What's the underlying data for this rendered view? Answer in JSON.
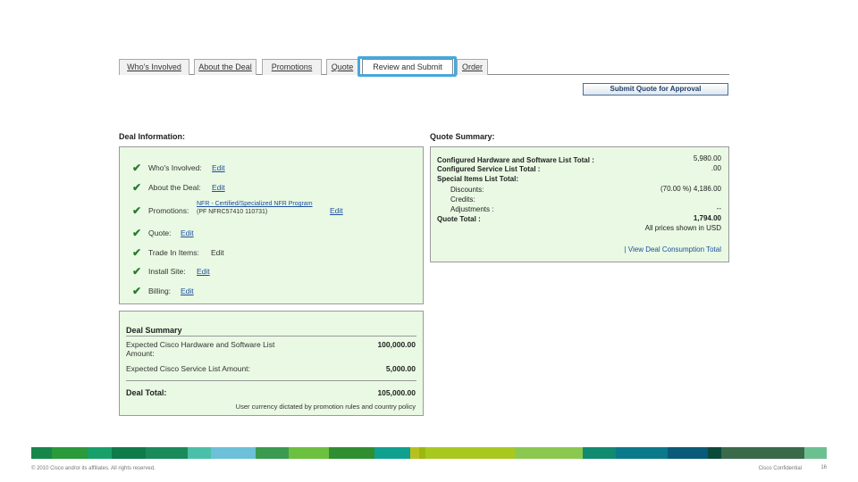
{
  "tabs": [
    {
      "label": "Who's Involved",
      "active": false
    },
    {
      "label": "About the Deal",
      "active": false
    },
    {
      "label": "Promotions",
      "active": false
    },
    {
      "label": "Quote",
      "active": false
    },
    {
      "label": "Review and Submit",
      "active": true
    },
    {
      "label": "Order",
      "active": false
    }
  ],
  "submit_button": "Submit Quote for Approval",
  "deal_information": {
    "heading": "Deal Information:",
    "rows": [
      {
        "label": "Who's Involved:",
        "edit": "Edit"
      },
      {
        "label": "About the Deal:",
        "edit": "Edit"
      },
      {
        "label": "Promotions:",
        "edit": "Edit",
        "promo_name": "NFR - Certified/Specialized NFR Program",
        "promo_code": "(PF NFRC57410 110731)"
      },
      {
        "label": "Quote:",
        "edit": "Edit"
      },
      {
        "label": "Trade In Items:",
        "edit": "Edit"
      },
      {
        "label": "Install Site:",
        "edit": "Edit"
      },
      {
        "label": "Billing:",
        "edit": "Edit"
      }
    ],
    "check_glyph": "✔"
  },
  "quote_summary": {
    "heading": "Quote Summary:",
    "config_hw_sw_label": "Configured Hardware and Software List Total :",
    "config_hw_sw_value": "5,980.00",
    "config_service_label": "Configured Service List Total :",
    "config_service_value": ".00",
    "special_items_label": "Special Items List Total:",
    "discounts_label": "Discounts:",
    "discounts_value": "(70.00 %) 4,186.00",
    "credits_label": "Credits:",
    "adjustments_label": "Adjustments :",
    "adjustments_value": "--",
    "quote_total_label": "Quote Total :",
    "quote_total_value": "1,794.00",
    "currency_note": "All prices shown in USD",
    "consumption_link": "| View Deal Consumption Total"
  },
  "deal_summary": {
    "title": "Deal Summary",
    "hw_sw_label": "Expected Cisco Hardware and Software List Amount:",
    "hw_sw_value": "100,000.00",
    "service_label": "Expected Cisco Service List Amount:",
    "service_value": "5,000.00",
    "total_label": "Deal Total:",
    "total_value": "105,000.00",
    "note": "User currency dictated by promotion rules and country policy"
  },
  "footer": {
    "copyright": "© 2010 Cisco and/or its affiliates. All rights reserved.",
    "confidential": "Cisco Confidential",
    "page": "16"
  },
  "colors": {
    "panel_bg": "#e9f9e3",
    "link": "#1f4fa0",
    "tab_highlight": "#47a8dc",
    "check": "#2d7a2d"
  },
  "color_bar": [
    "#16864a",
    "#2a9a3a",
    "#18a06a",
    "#0f7a4a",
    "#1a8a5a",
    "#4bbfa8",
    "#6cc0d8",
    "#3a9a50",
    "#6cc040",
    "#2f8f30",
    "#0fa090",
    "#b8c020",
    "#9ab810",
    "#a8c820",
    "#8ac850",
    "#118a70",
    "#0a7a8a",
    "#0a5a7a",
    "#0a4a3a",
    "#3a6a4a",
    "#6cc090"
  ]
}
